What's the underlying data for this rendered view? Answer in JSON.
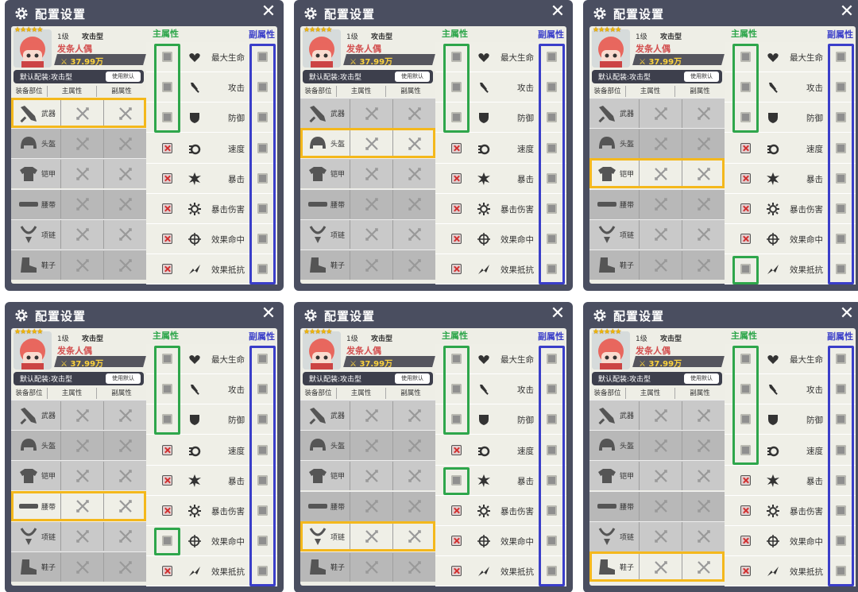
{
  "colors": {
    "main_attr": "#2ea64b",
    "sub_attr": "#3a3ec9",
    "highlight": "#f4b81c",
    "panel": "#4a4e60"
  },
  "dialog": {
    "title": "配置设置",
    "close_icon": "close-icon",
    "gear_icon": "gear-icon"
  },
  "character": {
    "stars": "★★★★★",
    "level": "1级",
    "type": "攻击型",
    "name": "发条人偶",
    "power": "37.99万"
  },
  "preset": {
    "label": "默认配装:攻击型",
    "button": "使用默认"
  },
  "table_header": [
    "装备部位",
    "主属性",
    "副属性"
  ],
  "attr_labels": {
    "main": "主属性",
    "sub": "副属性"
  },
  "slots": [
    {
      "label": "武器",
      "icon": "weapon-icon"
    },
    {
      "label": "头盔",
      "icon": "helmet-icon"
    },
    {
      "label": "铠甲",
      "icon": "armor-icon"
    },
    {
      "label": "腰带",
      "icon": "belt-icon"
    },
    {
      "label": "项链",
      "icon": "necklace-icon"
    },
    {
      "label": "鞋子",
      "icon": "shoes-icon"
    }
  ],
  "stats": [
    {
      "label": "最大生命",
      "icon": "heart-icon"
    },
    {
      "label": "攻击",
      "icon": "sword-icon"
    },
    {
      "label": "防御",
      "icon": "shield-icon"
    },
    {
      "label": "速度",
      "icon": "speed-icon"
    },
    {
      "label": "暴击",
      "icon": "crit-icon"
    },
    {
      "label": "暴击伤害",
      "icon": "crit-damage-icon"
    },
    {
      "label": "效果命中",
      "icon": "accuracy-icon"
    },
    {
      "label": "效果抵抗",
      "icon": "resist-icon"
    }
  ],
  "panels": [
    {
      "selected_slot": 0,
      "main_enabled": [
        1,
        1,
        1,
        0,
        0,
        0,
        0,
        0
      ]
    },
    {
      "selected_slot": 1,
      "main_enabled": [
        1,
        1,
        1,
        0,
        0,
        0,
        0,
        0
      ]
    },
    {
      "selected_slot": 2,
      "main_enabled": [
        1,
        1,
        1,
        0,
        0,
        0,
        0,
        1
      ]
    },
    {
      "selected_slot": 3,
      "main_enabled": [
        1,
        1,
        1,
        0,
        0,
        0,
        1,
        0
      ]
    },
    {
      "selected_slot": 4,
      "main_enabled": [
        1,
        1,
        1,
        0,
        1,
        0,
        0,
        0
      ]
    },
    {
      "selected_slot": 5,
      "main_enabled": [
        1,
        1,
        1,
        1,
        0,
        0,
        0,
        0
      ]
    }
  ]
}
